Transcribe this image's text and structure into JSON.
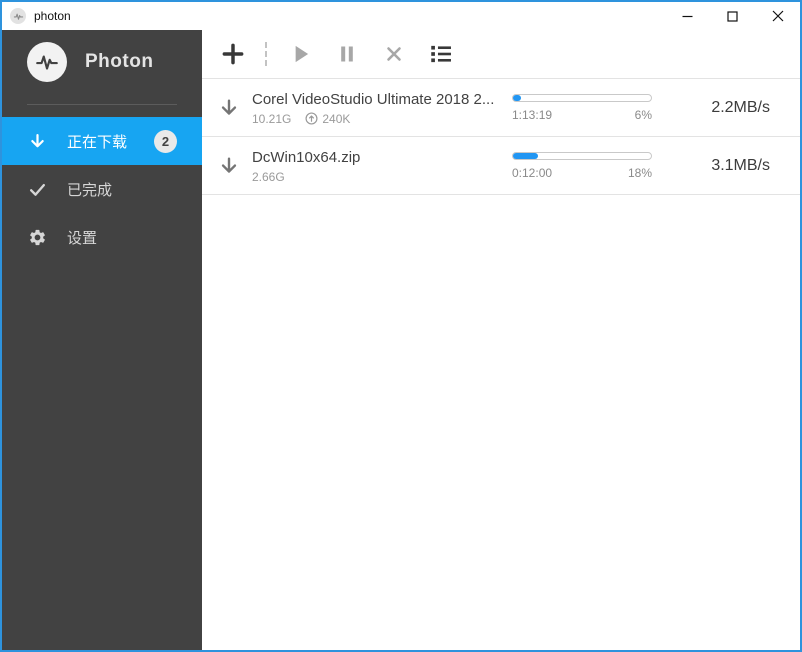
{
  "titlebar": {
    "title": "photon"
  },
  "sidebar": {
    "app_name": "Photon",
    "items": [
      {
        "label": "正在下载",
        "badge": "2",
        "selected": true
      },
      {
        "label": "已完成",
        "selected": false
      },
      {
        "label": "设置",
        "selected": false
      }
    ]
  },
  "toolbar": {
    "buttons": [
      "add",
      "resume",
      "pause",
      "cancel",
      "list"
    ]
  },
  "downloads": [
    {
      "name": "Corel VideoStudio Ultimate 2018 2...",
      "size": "10.21G",
      "upload_rate": "240K",
      "time": "1:13:19",
      "percent_label": "6%",
      "percent": 6,
      "speed": "2.2MB/s"
    },
    {
      "name": "DcWin10x64.zip",
      "size": "2.66G",
      "time": "0:12:00",
      "percent_label": "18%",
      "percent": 18,
      "speed": "3.1MB/s"
    }
  ],
  "icons": {
    "photon_logo": "waveform-pulse",
    "minimize": "horizontal-line",
    "maximize": "square-outline",
    "close": "x",
    "downloading_nav": "arrow-down",
    "completed_nav": "checkmark",
    "settings_nav": "gear",
    "add": "plus",
    "resume": "play-triangle",
    "pause": "pause-bars",
    "cancel": "x",
    "list": "bulleted-list",
    "download_item": "arrow-down",
    "upload": "arrow-up-in-circle"
  },
  "colors": {
    "window_border": "#2e93dd",
    "sidebar_bg": "#424242",
    "selected_item_bg": "#17a5f2",
    "progress_fill": "#2196f3",
    "badge_bg": "#e9e9e9"
  }
}
